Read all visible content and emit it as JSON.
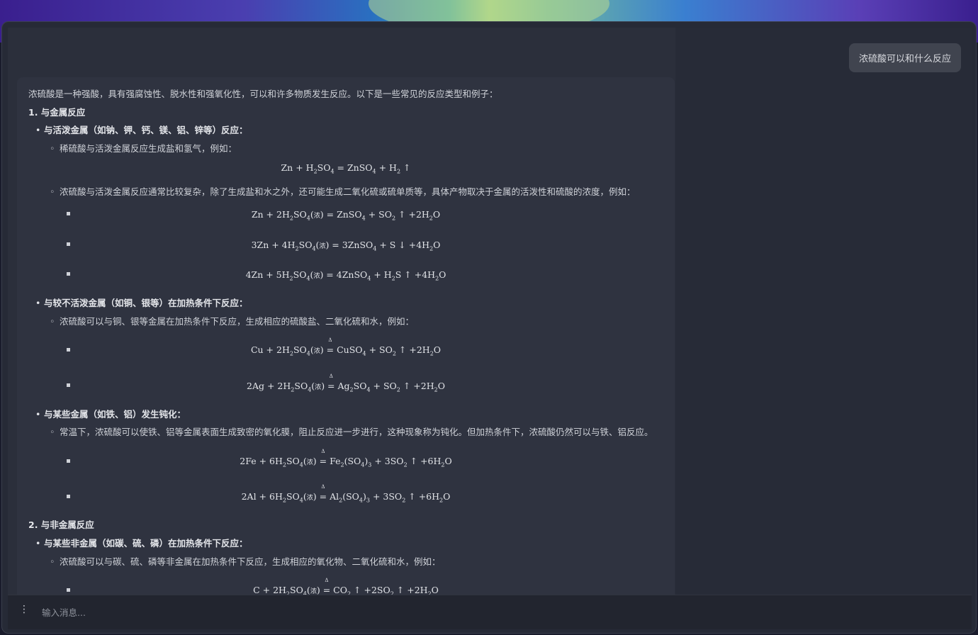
{
  "user_message": "浓硫酸可以和什么反应",
  "answer": {
    "intro": "浓硫酸是一种强酸，具有强腐蚀性、脱水性和强氧化性，可以和许多物质发生反应。以下是一些常见的反应类型和例子：",
    "section1": {
      "title": "1. 与金属反应",
      "active_metals": "与活泼金属（如钠、钾、钙、镁、铝、锌等）反应：",
      "dilute_note": "稀硫酸与活泼金属反应生成盐和氢气，例如：",
      "conc_note": "浓硫酸与活泼金属反应通常比较复杂，除了生成盐和水之外，还可能生成二氧化硫或硫单质等，具体产物取决于金属的活泼性和硫酸的浓度，例如：",
      "less_active": "与较不活泼金属（如铜、银等）在加热条件下反应：",
      "less_active_note": "浓硫酸可以与铜、银等金属在加热条件下反应，生成相应的硫酸盐、二氧化硫和水，例如：",
      "passivation": "与某些金属（如铁、铝）发生钝化：",
      "passivation_note": "常温下，浓硫酸可以使铁、铝等金属表面生成致密的氧化膜，阻止反应进一步进行，这种现象称为钝化。但加热条件下，浓硫酸仍然可以与铁、铝反应。"
    },
    "section2": {
      "title": "2. 与非金属反应",
      "nonmetals": "与某些非金属（如碳、硫、磷）在加热条件下反应：",
      "nonmetals_note": "浓硫酸可以与碳、硫、磷等非金属在加热条件下反应，生成相应的氧化物、二氧化硫和水，例如："
    },
    "equation_conc_label": "浓"
  },
  "input": {
    "placeholder": "输入消息..."
  },
  "icons": {
    "menu": "more-vertical-icon"
  }
}
